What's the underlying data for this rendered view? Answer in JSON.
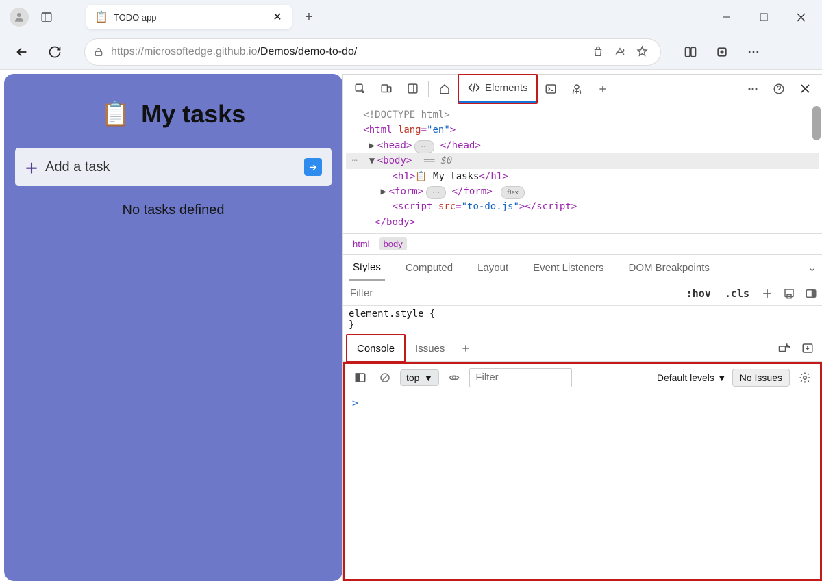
{
  "browser": {
    "tab_title": "TODO app",
    "url_host": "https://microsoftedge.github.io",
    "url_path": "/Demos/demo-to-do/"
  },
  "page": {
    "heading": "My tasks",
    "input_placeholder": "Add a task",
    "empty_msg": "No tasks defined"
  },
  "devtools": {
    "tabs": {
      "elements": "Elements"
    },
    "dom": {
      "doctype": "<!DOCTYPE html>",
      "html_open": "html",
      "html_lang_attr": "lang",
      "html_lang_val": "\"en\"",
      "head": "head",
      "body": "body",
      "body_ref": "== $0",
      "h1": "h1",
      "h1_text": "📋 My tasks",
      "form": "form",
      "form_badge": "flex",
      "script": "script",
      "script_attr": "src",
      "script_val": "\"to-do.js\""
    },
    "crumbs": {
      "html": "html",
      "body": "body"
    },
    "subtabs": {
      "styles": "Styles",
      "computed": "Computed",
      "layout": "Layout",
      "listeners": "Event Listeners",
      "dom_bp": "DOM Breakpoints"
    },
    "filter_placeholder": "Filter",
    "hov": ":hov",
    "cls": ".cls",
    "style_code_1": "element.style {",
    "style_code_2": "}",
    "drawer": {
      "console": "Console",
      "issues": "Issues",
      "context": "top",
      "filter_placeholder": "Filter",
      "levels": "Default levels",
      "no_issues": "No Issues",
      "prompt": ">"
    }
  }
}
